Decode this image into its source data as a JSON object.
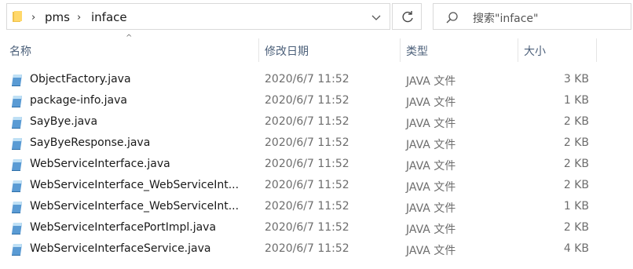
{
  "address": {
    "crumbs": [
      "pms",
      "inface"
    ]
  },
  "search": {
    "placeholder": "搜索\"inface\""
  },
  "columns": {
    "name": "名称",
    "date": "修改日期",
    "type": "类型",
    "size": "大小"
  },
  "files": [
    {
      "name": "ObjectFactory.java",
      "date": "2020/6/7 11:52",
      "type": "JAVA 文件",
      "size": "3 KB"
    },
    {
      "name": "package-info.java",
      "date": "2020/6/7 11:52",
      "type": "JAVA 文件",
      "size": "1 KB"
    },
    {
      "name": "SayBye.java",
      "date": "2020/6/7 11:52",
      "type": "JAVA 文件",
      "size": "2 KB"
    },
    {
      "name": "SayByeResponse.java",
      "date": "2020/6/7 11:52",
      "type": "JAVA 文件",
      "size": "2 KB"
    },
    {
      "name": "WebServiceInterface.java",
      "date": "2020/6/7 11:52",
      "type": "JAVA 文件",
      "size": "2 KB"
    },
    {
      "name": "WebServiceInterface_WebServiceInt...",
      "date": "2020/6/7 11:52",
      "type": "JAVA 文件",
      "size": "2 KB"
    },
    {
      "name": "WebServiceInterface_WebServiceInt...",
      "date": "2020/6/7 11:52",
      "type": "JAVA 文件",
      "size": "1 KB"
    },
    {
      "name": "WebServiceInterfacePortImpl.java",
      "date": "2020/6/7 11:52",
      "type": "JAVA 文件",
      "size": "2 KB"
    },
    {
      "name": "WebServiceInterfaceService.java",
      "date": "2020/6/7 11:52",
      "type": "JAVA 文件",
      "size": "4 KB"
    }
  ]
}
